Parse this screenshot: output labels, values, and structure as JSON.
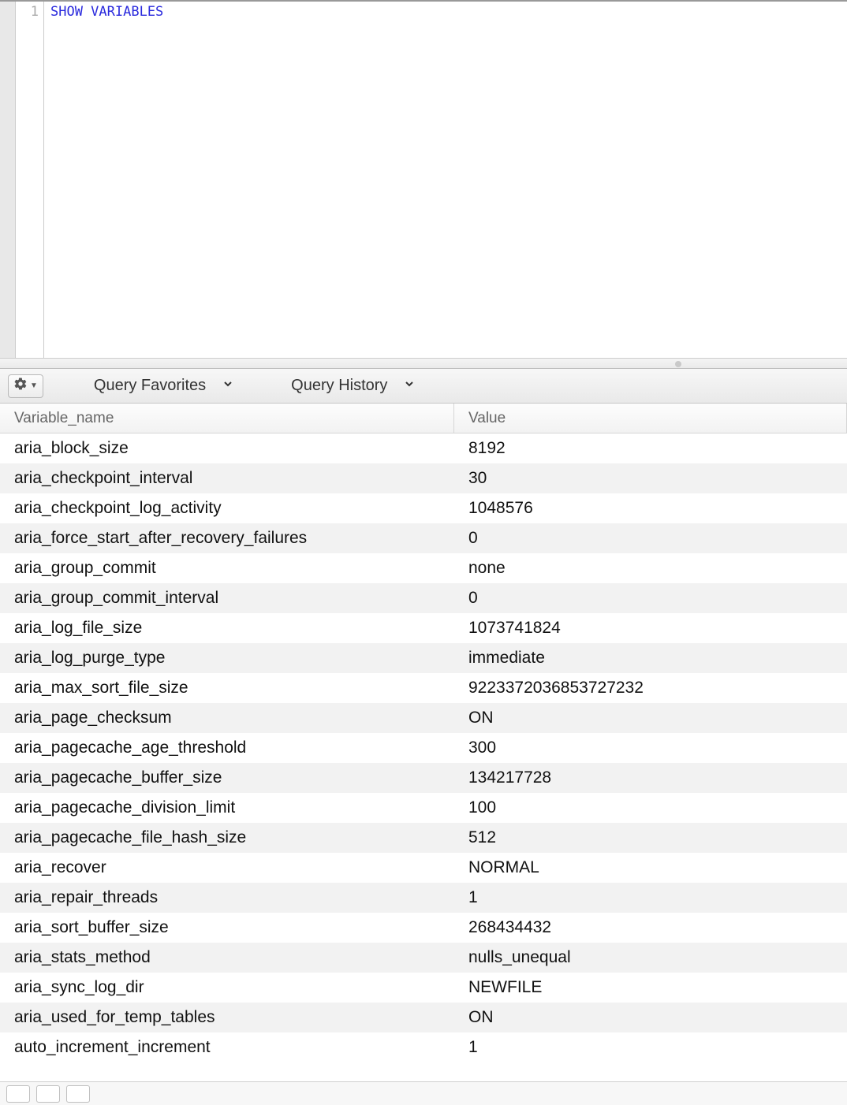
{
  "editor": {
    "line_number": "1",
    "sql_keyword": "SHOW VARIABLES"
  },
  "toolbar": {
    "favorites_label": "Query Favorites",
    "history_label": "Query History"
  },
  "results": {
    "columns": {
      "name": "Variable_name",
      "value": "Value"
    },
    "rows": [
      {
        "name": "aria_block_size",
        "value": "8192"
      },
      {
        "name": "aria_checkpoint_interval",
        "value": "30"
      },
      {
        "name": "aria_checkpoint_log_activity",
        "value": "1048576"
      },
      {
        "name": "aria_force_start_after_recovery_failures",
        "value": "0"
      },
      {
        "name": "aria_group_commit",
        "value": "none"
      },
      {
        "name": "aria_group_commit_interval",
        "value": "0"
      },
      {
        "name": "aria_log_file_size",
        "value": "1073741824"
      },
      {
        "name": "aria_log_purge_type",
        "value": "immediate"
      },
      {
        "name": "aria_max_sort_file_size",
        "value": "9223372036853727232"
      },
      {
        "name": "aria_page_checksum",
        "value": "ON"
      },
      {
        "name": "aria_pagecache_age_threshold",
        "value": "300"
      },
      {
        "name": "aria_pagecache_buffer_size",
        "value": "134217728"
      },
      {
        "name": "aria_pagecache_division_limit",
        "value": "100"
      },
      {
        "name": "aria_pagecache_file_hash_size",
        "value": "512"
      },
      {
        "name": "aria_recover",
        "value": "NORMAL"
      },
      {
        "name": "aria_repair_threads",
        "value": "1"
      },
      {
        "name": "aria_sort_buffer_size",
        "value": "268434432"
      },
      {
        "name": "aria_stats_method",
        "value": "nulls_unequal"
      },
      {
        "name": "aria_sync_log_dir",
        "value": "NEWFILE"
      },
      {
        "name": "aria_used_for_temp_tables",
        "value": "ON"
      },
      {
        "name": "auto_increment_increment",
        "value": "1"
      }
    ]
  }
}
